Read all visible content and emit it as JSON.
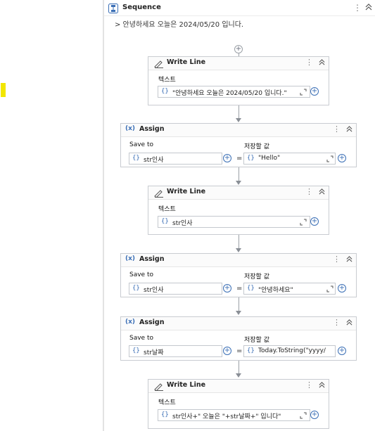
{
  "sequence": {
    "title": "Sequence",
    "log_output": "> 안녕하세요 오늘은 2024/05/20 입니다."
  },
  "activities": [
    {
      "type": "Write Line",
      "field_label": "텍스트",
      "value": "\"안녕하세요 오늘은 2024/05/20 입니다.\""
    },
    {
      "type": "Assign",
      "save_to_label": "Save to",
      "value_label": "저장할 값",
      "save_to": "str인사",
      "value": "\"Hello\""
    },
    {
      "type": "Write Line",
      "field_label": "텍스트",
      "value": "str인사"
    },
    {
      "type": "Assign",
      "save_to_label": "Save to",
      "value_label": "저장할 값",
      "save_to": "str인사",
      "value": "\"안녕하세요\""
    },
    {
      "type": "Assign",
      "save_to_label": "Save to",
      "value_label": "저장할 값",
      "save_to": "str날짜",
      "value": "Today.ToString(\"yyyy/"
    },
    {
      "type": "Write Line",
      "field_label": "텍스트",
      "value": "str인사+\" 오늘은 \"+str날짜+\" 입니다\""
    }
  ],
  "symbols": {
    "dots": "⋮",
    "collapse": "⌃⌃",
    "plus": "+",
    "brace": "{}",
    "equals": "=",
    "assign_icon": "(x)"
  },
  "colors": {
    "accent": "#3b6fb6",
    "marker": "#f2e600"
  }
}
